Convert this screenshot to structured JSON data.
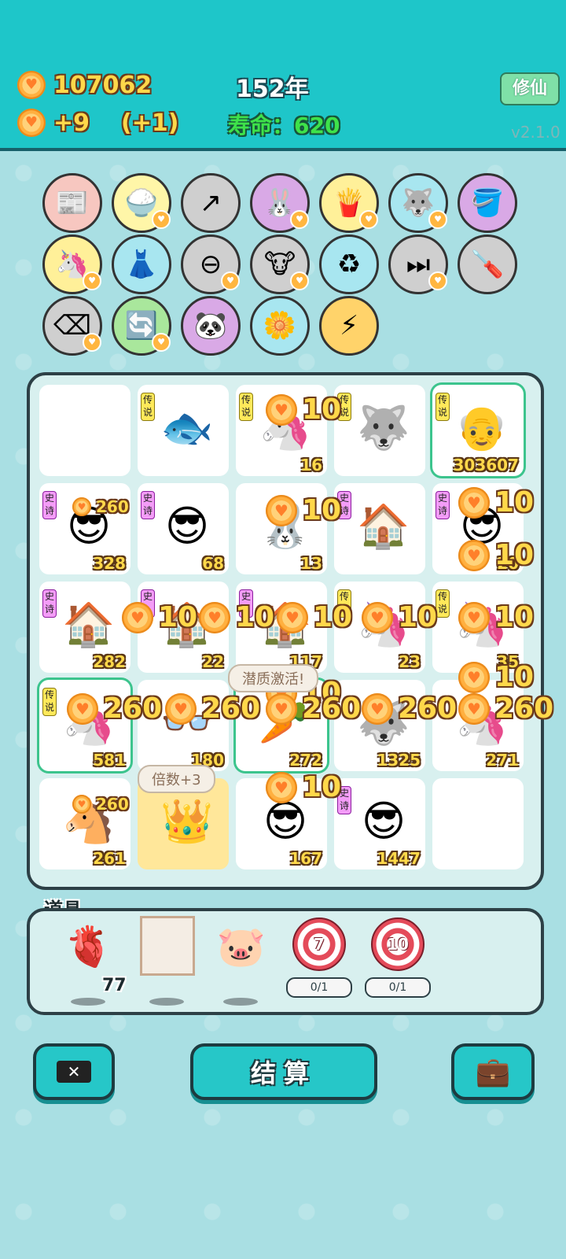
{
  "header": {
    "coins": "107062",
    "income": "+9",
    "income_bonus": "(+1)",
    "year": "152年",
    "lifespan_label": "寿命：",
    "lifespan_value": "620",
    "cultivate_button": "修仙",
    "version": "v2.1.0"
  },
  "owned_items": [
    {
      "icon": "time-magazine-icon",
      "glyph": "📰",
      "bg": "#f7c7c0",
      "badge": false
    },
    {
      "icon": "rice-bowl-icon",
      "glyph": "🍚",
      "bg": "#fff6a8",
      "badge": true
    },
    {
      "icon": "arrow-card-icon",
      "glyph": "↗",
      "bg": "#cfcfcf",
      "badge": false
    },
    {
      "icon": "rabbit-icon",
      "glyph": "🐰",
      "bg": "#d9a9e6",
      "badge": true
    },
    {
      "icon": "fries-icon",
      "glyph": "🍟",
      "bg": "#fff099",
      "badge": true
    },
    {
      "icon": "husky-icon",
      "glyph": "🐺",
      "bg": "#a8e6f0",
      "badge": true
    },
    {
      "icon": "bucket-100-icon",
      "glyph": "🪣",
      "bg": "#d9a9e6",
      "badge": false
    },
    {
      "icon": "unicorn-icon",
      "glyph": "🦄",
      "bg": "#fff099",
      "badge": true
    },
    {
      "icon": "skirt-icon",
      "glyph": "👗",
      "bg": "#a8e6f0",
      "badge": false
    },
    {
      "icon": "minus-circle-icon",
      "glyph": "⊖",
      "bg": "#cfcfcf",
      "badge": true
    },
    {
      "icon": "cows-icon",
      "glyph": "🐮",
      "bg": "#cfcfcf",
      "badge": true
    },
    {
      "icon": "recycle-bag-icon",
      "glyph": "♻",
      "bg": "#a8e6f0",
      "badge": false
    },
    {
      "icon": "skip-icon",
      "glyph": "⏭",
      "bg": "#cfcfcf",
      "badge": true
    },
    {
      "icon": "screwdriver-icon",
      "glyph": "🪛",
      "bg": "#cfcfcf",
      "badge": false
    },
    {
      "icon": "delete-key-icon",
      "glyph": "⌫",
      "bg": "#cfcfcf",
      "badge": true
    },
    {
      "icon": "refresh-icon",
      "glyph": "🔄",
      "bg": "#a9e79c",
      "badge": true
    },
    {
      "icon": "panda-icon",
      "glyph": "🐼",
      "bg": "#d9a9e6",
      "badge": false
    },
    {
      "icon": "flower-pot-icon",
      "glyph": "🌼",
      "bg": "#a8e6f0",
      "badge": false
    },
    {
      "icon": "lightning-icon",
      "glyph": "⚡",
      "bg": "#ffd36a",
      "badge": false
    }
  ],
  "board": [
    {
      "tag": "",
      "tagc": "",
      "glyph": "",
      "num": "",
      "legend": false
    },
    {
      "tag": "传说",
      "tagc": "y",
      "glyph": "🐟",
      "num": "",
      "legend": false
    },
    {
      "tag": "传说",
      "tagc": "y",
      "glyph": "🦄",
      "num": "16",
      "legend": false
    },
    {
      "tag": "传说",
      "tagc": "y",
      "glyph": "🐺",
      "num": "",
      "legend": false
    },
    {
      "tag": "传说",
      "tagc": "y",
      "glyph": "👴",
      "num": "303607",
      "legend": true
    },
    {
      "tag": "史诗",
      "tagc": "p",
      "glyph": "😎",
      "num": "328",
      "legend": false
    },
    {
      "tag": "史诗",
      "tagc": "p",
      "glyph": "😎",
      "num": "68",
      "legend": false
    },
    {
      "tag": "",
      "tagc": "",
      "glyph": "🐰",
      "num": "13",
      "legend": false
    },
    {
      "tag": "史诗",
      "tagc": "p",
      "glyph": "🏠",
      "num": "",
      "legend": false
    },
    {
      "tag": "史诗",
      "tagc": "p",
      "glyph": "😎",
      "num": "20",
      "legend": false
    },
    {
      "tag": "史诗",
      "tagc": "p",
      "glyph": "🏠",
      "num": "282",
      "legend": false
    },
    {
      "tag": "史",
      "tagc": "p",
      "glyph": "🏠",
      "num": "22",
      "legend": false
    },
    {
      "tag": "史",
      "tagc": "p",
      "glyph": "🏠",
      "num": "117",
      "legend": false
    },
    {
      "tag": "传",
      "tagc": "y",
      "glyph": "🦄",
      "num": "23",
      "legend": false
    },
    {
      "tag": "传说",
      "tagc": "y",
      "glyph": "🦄",
      "num": "35",
      "legend": false
    },
    {
      "tag": "传说",
      "tagc": "y",
      "glyph": "🦄",
      "num": "581",
      "legend": true
    },
    {
      "tag": "",
      "tagc": "",
      "glyph": "👓",
      "num": "180",
      "legend": false
    },
    {
      "tag": "",
      "tagc": "",
      "glyph": "🥕",
      "num": "272",
      "legend": true
    },
    {
      "tag": "",
      "tagc": "",
      "glyph": "🐺",
      "num": "1325",
      "legend": false
    },
    {
      "tag": "",
      "tagc": "",
      "glyph": "🦄",
      "num": "271",
      "legend": false
    },
    {
      "tag": "",
      "tagc": "",
      "glyph": "🐴",
      "num": "261",
      "legend": false
    },
    {
      "tag": "",
      "tagc": "",
      "glyph": "👑",
      "num": "",
      "legend": false
    },
    {
      "tag": "",
      "tagc": "",
      "glyph": "😎",
      "num": "167",
      "legend": false
    },
    {
      "tag": "史诗",
      "tagc": "p",
      "glyph": "😎",
      "num": "1447",
      "legend": false
    },
    {
      "tag": "",
      "tagc": "",
      "glyph": "",
      "num": "",
      "legend": false
    }
  ],
  "popups": [
    {
      "v": "10"
    },
    {
      "v": "10"
    },
    {
      "v": "10"
    },
    {
      "v": "10"
    },
    {
      "v": "260"
    },
    {
      "v": "10"
    },
    {
      "v": "10"
    },
    {
      "v": "10"
    },
    {
      "v": "10"
    },
    {
      "v": "10"
    },
    {
      "v": "10"
    },
    {
      "v": "10"
    },
    {
      "v": "260"
    },
    {
      "v": "260"
    },
    {
      "v": "260"
    },
    {
      "v": "260"
    },
    {
      "v": "260"
    },
    {
      "v": "10"
    },
    {
      "v": "260"
    }
  ],
  "bubbles": {
    "activated": "潜质激活!",
    "multiplier": "倍数+3"
  },
  "props": {
    "title": "道具",
    "liver_count": "77",
    "target7": "7",
    "target7_uses": "0/1",
    "target10": "10",
    "target10_uses": "0/1"
  },
  "buttons": {
    "settle": "结算"
  }
}
